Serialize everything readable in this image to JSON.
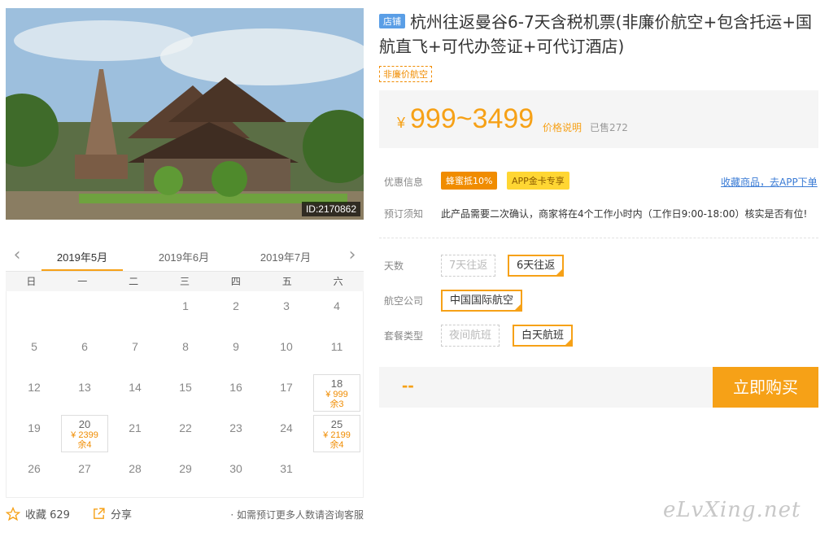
{
  "photo": {
    "id_label": "ID:2170862"
  },
  "calendar": {
    "months": [
      "2019年5月",
      "2019年6月",
      "2019年7月"
    ],
    "weekdays": [
      "日",
      "一",
      "二",
      "三",
      "四",
      "五",
      "六"
    ],
    "days": {
      "1": "1",
      "2": "2",
      "3": "3",
      "4": "4",
      "5": "5",
      "6": "6",
      "7": "7",
      "8": "8",
      "9": "9",
      "10": "10",
      "11": "11",
      "12": "12",
      "13": "13",
      "14": "14",
      "15": "15",
      "16": "16",
      "17": "17",
      "18": "18",
      "19": "19",
      "20": "20",
      "21": "21",
      "22": "22",
      "23": "23",
      "24": "24",
      "25": "25",
      "26": "26",
      "27": "27",
      "28": "28",
      "29": "29",
      "30": "30",
      "31": "31"
    },
    "priced": {
      "18": {
        "price": "¥ 999",
        "remain": "余3"
      },
      "20": {
        "price": "¥ 2399",
        "remain": "余4"
      },
      "25": {
        "price": "¥ 2199",
        "remain": "余4"
      }
    }
  },
  "footer": {
    "favorite_label": "收藏 629",
    "share_label": "分享",
    "note": "· 如需预订更多人数请咨询客服"
  },
  "product": {
    "shop_tag": "店铺",
    "title": "杭州往返曼谷6-7天含税机票(非廉价航空+包含托运+国航直飞+可代办签证+可代订酒店)",
    "mini_tag": "非廉价航空"
  },
  "price": {
    "currency": "¥",
    "range": "999~3499",
    "explain_link": "价格说明",
    "sold": "已售272"
  },
  "promo": {
    "label": "优惠信息",
    "badge_bee": "蜂蜜抵10%",
    "badge_app": "APP金卡专享",
    "app_link": "收藏商品，去APP下单"
  },
  "notice": {
    "label": "预订须知",
    "text": "此产品需要二次确认，商家将在4个工作小时内（工作日9:00-18:00）核实是否有位!"
  },
  "options": {
    "days_label": "天数",
    "days": [
      "7天往返",
      "6天往返"
    ],
    "airline_label": "航空公司",
    "airline": "中国国际航空",
    "package_label": "套餐类型",
    "package": [
      "夜间航班",
      "白天航班"
    ]
  },
  "buy": {
    "total": "--",
    "button": "立即购买"
  },
  "watermark": "eLvXing.net",
  "colors": {
    "accent": "#f6a117",
    "link": "#3a7bd5",
    "shop_tag": "#5a9ee6"
  }
}
